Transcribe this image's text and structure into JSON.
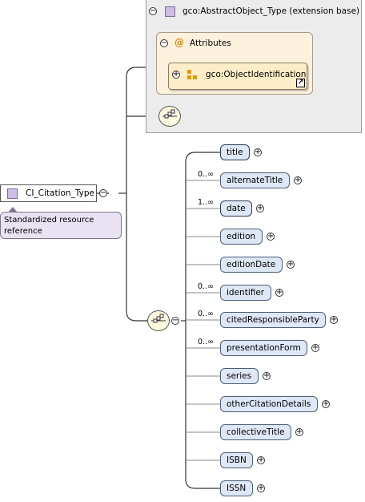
{
  "extension": {
    "title": "gco:AbstractObject_Type (extension base)",
    "attributes_label": "Attributes",
    "attribute_group": "gco:ObjectIdentification"
  },
  "type_box": {
    "label": "CI_Citation_Type"
  },
  "documentation": {
    "text": "Standardized resource reference"
  },
  "elements": [
    {
      "name": "title",
      "occurs": "",
      "required": true
    },
    {
      "name": "alternateTitle",
      "occurs": "0..∞",
      "required": false
    },
    {
      "name": "date",
      "occurs": "1..∞",
      "required": true
    },
    {
      "name": "edition",
      "occurs": "",
      "required": false
    },
    {
      "name": "editionDate",
      "occurs": "",
      "required": false
    },
    {
      "name": "identifier",
      "occurs": "0..∞",
      "required": false
    },
    {
      "name": "citedResponsibleParty",
      "occurs": "0..∞",
      "required": false
    },
    {
      "name": "presentationForm",
      "occurs": "0..∞",
      "required": false
    },
    {
      "name": "series",
      "occurs": "",
      "required": false
    },
    {
      "name": "otherCitationDetails",
      "occurs": "",
      "required": false
    },
    {
      "name": "collectiveTitle",
      "occurs": "",
      "required": false
    },
    {
      "name": "ISBN",
      "occurs": "",
      "required": false
    },
    {
      "name": "ISSN",
      "occurs": "",
      "required": false
    }
  ],
  "colors": {
    "element_fill": "#dde7f5",
    "attribute_fill": "#fbf1dc",
    "extension_fill": "#ececec",
    "doc_fill": "#e8e2f2",
    "type_icon": "#cdbde6"
  },
  "icons": {
    "collapse": "minus-circle",
    "expand": "plus-circle",
    "sequence": "sequence-compositor",
    "attributes": "at-sign",
    "attribute_group": "attribute-group-squares",
    "link": "link-arrow"
  }
}
